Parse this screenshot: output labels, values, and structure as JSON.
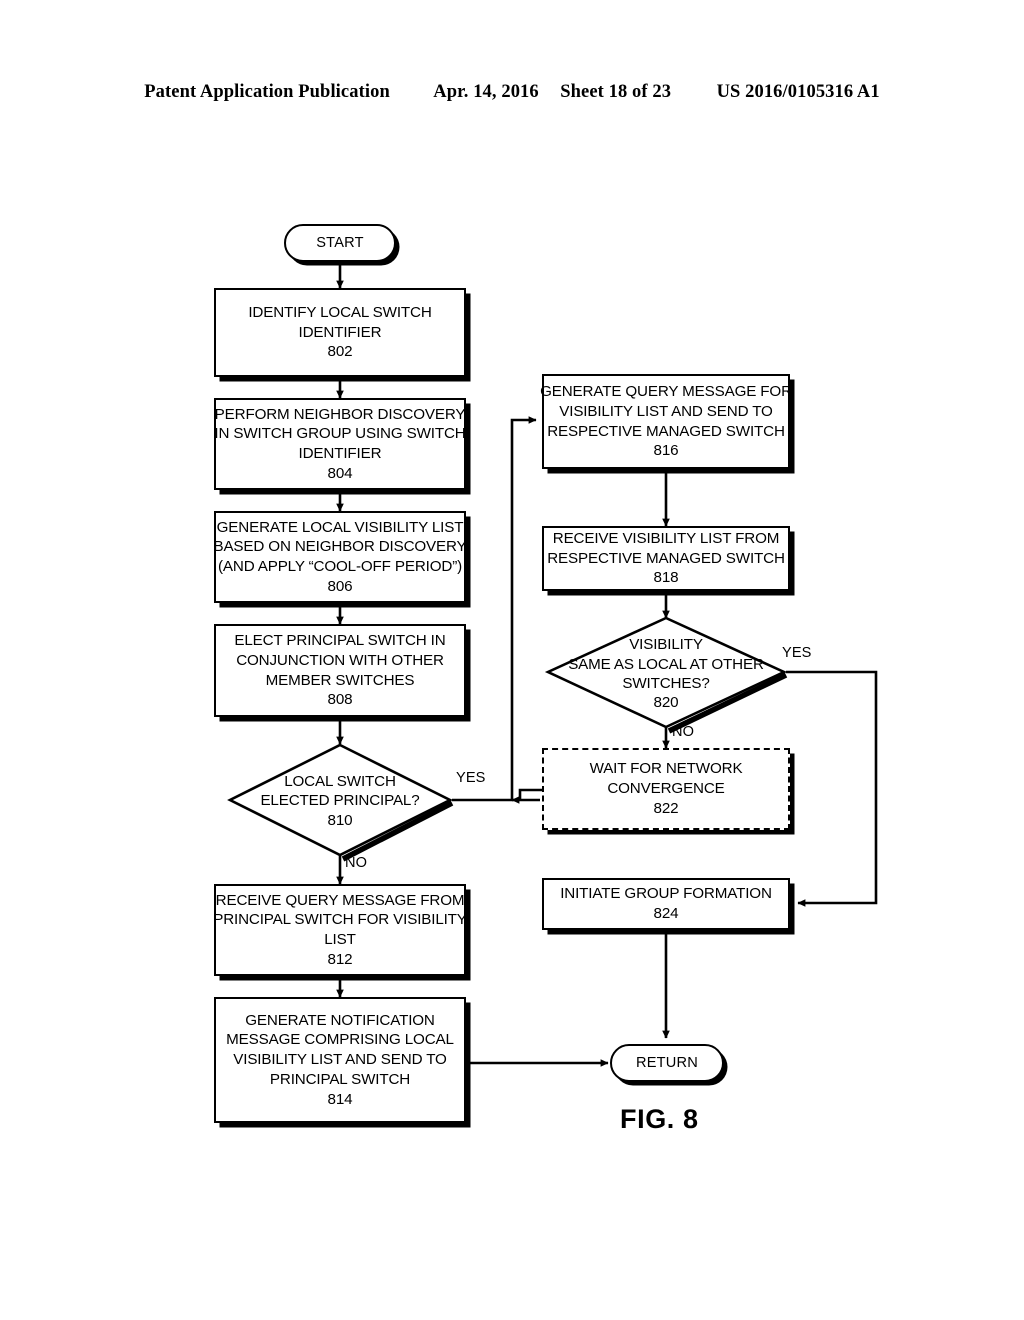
{
  "header": {
    "publication": "Patent Application Publication",
    "date": "Apr. 14, 2016",
    "sheet": "Sheet 18 of 23",
    "patent_number": "US 2016/0105316 A1"
  },
  "figure": {
    "caption": "FIG. 8",
    "line_color": "#000000",
    "fill_color": "#ffffff"
  },
  "nodes": {
    "start": {
      "label": "START"
    },
    "n802": {
      "l1": "IDENTIFY LOCAL SWITCH",
      "l2": "IDENTIFIER",
      "ref": "802"
    },
    "n804": {
      "l1": "PERFORM NEIGHBOR DISCOVERY",
      "l2": "IN SWITCH GROUP USING SWITCH",
      "l3": "IDENTIFIER",
      "ref": "804"
    },
    "n806": {
      "l1": "GENERATE LOCAL VISIBILITY LIST",
      "l2": "BASED ON NEIGHBOR DISCOVERY",
      "l3": "(AND APPLY “COOL-OFF PERIOD”)",
      "ref": "806"
    },
    "n808": {
      "l1": "ELECT PRINCIPAL SWITCH IN",
      "l2": "CONJUNCTION WITH OTHER",
      "l3": "MEMBER  SWITCHES",
      "ref": "808"
    },
    "n810": {
      "l1": "LOCAL SWITCH",
      "l2": "ELECTED PRINCIPAL?",
      "ref": "810"
    },
    "n812": {
      "l1": "RECEIVE QUERY MESSAGE FROM",
      "l2": "PRINCIPAL SWITCH FOR VISIBILITY",
      "l3": "LIST",
      "ref": "812"
    },
    "n814": {
      "l1": "GENERATE NOTIFICATION",
      "l2": "MESSAGE COMPRISING LOCAL",
      "l3": "VISIBILITY LIST AND SEND TO",
      "l4": "PRINCIPAL SWITCH",
      "ref": "814"
    },
    "n816": {
      "l1": "GENERATE QUERY MESSAGE FOR",
      "l2": "VISIBILITY LIST AND SEND TO",
      "l3": "RESPECTIVE MANAGED SWITCH",
      "ref": "816"
    },
    "n818": {
      "l1": "RECEIVE VISIBILITY LIST FROM",
      "l2": "RESPECTIVE MANAGED SWITCH",
      "ref": "818"
    },
    "n820": {
      "l1": "VISIBILITY",
      "l2": "SAME AS LOCAL AT OTHER",
      "l3": "SWITCHES?",
      "ref": "820"
    },
    "n822": {
      "l1": "WAIT FOR NETWORK",
      "l2": "CONVERGENCE",
      "ref": "822"
    },
    "n824": {
      "l1": "INITIATE GROUP FORMATION",
      "ref": "824"
    },
    "return": {
      "label": "RETURN"
    }
  },
  "branch_labels": {
    "yes_810": "YES",
    "no_810": "NO",
    "yes_820": "YES",
    "no_820": "NO"
  }
}
